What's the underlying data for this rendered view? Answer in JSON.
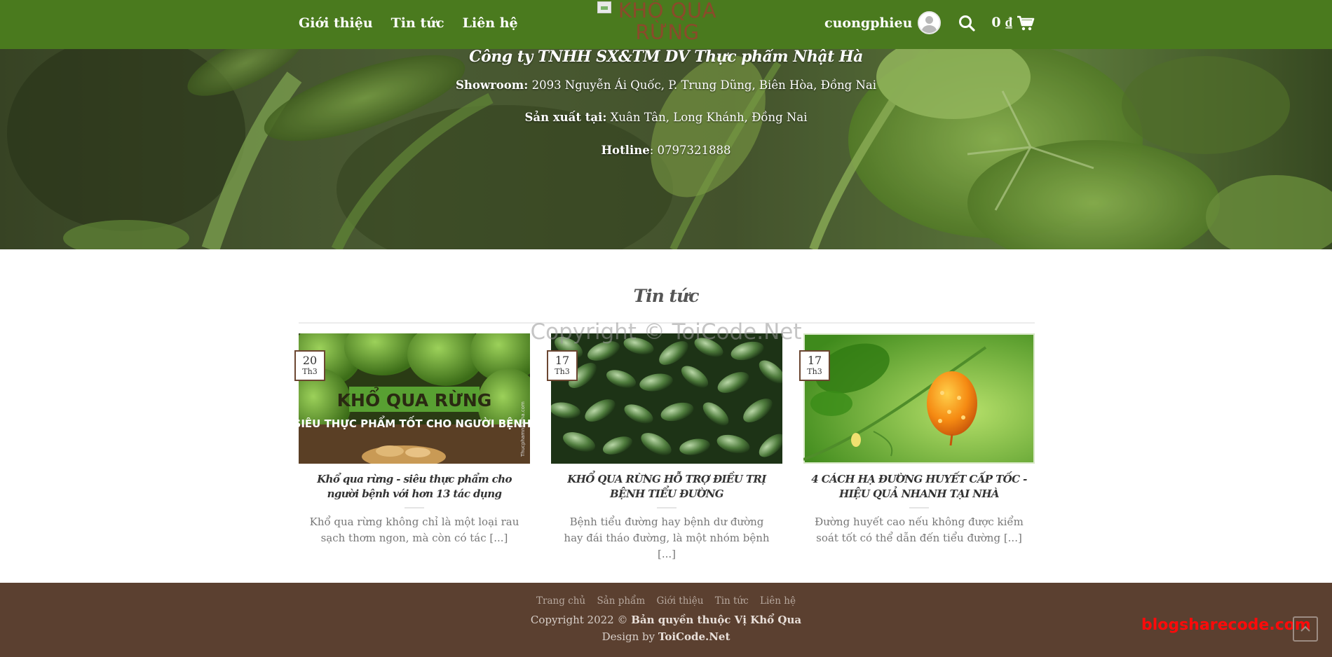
{
  "header": {
    "nav": [
      "Giới thiệu",
      "Tin tức",
      "Liên hệ"
    ],
    "logo_alt": "KHỔ QUA RỪNG",
    "username": "cuongphieu",
    "cart_total": "0 ₫",
    "icons": [
      "user-avatar-icon",
      "search-icon",
      "cart-icon"
    ]
  },
  "hero": {
    "company": "Công ty TNHH SX&TM DV Thực phẩm Nhật Hà",
    "showroom_label": "Showroom:",
    "showroom_value": " 2093 Nguyễn Ái Quốc, P. Trung Dũng, Biên Hòa, Đồng Nai",
    "production_label": "Sản xuất tại:",
    "production_value": " Xuân Tân, Long Khánh, Đồng Nai",
    "hotline_label": "Hotline",
    "hotline_value": ": 0797321888"
  },
  "news": {
    "title": "Tin tức",
    "watermark": "Copyright © ToiCode.Net",
    "posts": [
      {
        "day": "20",
        "month": "Th3",
        "image_text_1": "KHỔ QUA RỪNG",
        "image_text_2": "SIÊU THỰC PHẨM TỐT CHO NGƯỜI BỆNH",
        "image_side": "Thucphamnhatha.com",
        "title": "Khổ qua rừng - siêu thực phẩm cho người bệnh với hơn 13 tác dụng",
        "excerpt": "Khổ qua rừng không chỉ là một loại rau sạch thơm ngon, mà còn có tác [...]"
      },
      {
        "day": "17",
        "month": "Th3",
        "title": "KHỔ QUA RỪNG HỖ TRỢ ĐIỀU TRỊ BỆNH TIỂU ĐƯỜNG",
        "excerpt": "Bệnh tiểu đường hay bệnh dư đường hay đái tháo đường, là một nhóm bệnh [...]"
      },
      {
        "day": "17",
        "month": "Th3",
        "title": "4 CÁCH HẠ ĐƯỜNG HUYẾT CẤP TỐC - HIỆU QUẢ NHANH TẠI NHÀ",
        "excerpt": "Đường huyết cao nếu không được kiểm soát tốt có thể dẫn đến tiểu đường [...]"
      }
    ]
  },
  "footer": {
    "links": [
      "Trang chủ",
      "Sản phẩm",
      "Giới thiệu",
      "Tin tức",
      "Liên hệ"
    ],
    "copyright_prefix": "Copyright 2022 © ",
    "copyright_owner": "Bản quyền thuộc Vị Khổ Qua",
    "design_prefix": "Design by ",
    "design_owner": "ToiCode.Net",
    "blogshare": "blogsharecode.com"
  },
  "colors": {
    "header_green": "#4a7a1e",
    "footer_brown": "#5b4030",
    "badge_border": "#6b4631",
    "overlay_red": "#ff0a0a"
  }
}
